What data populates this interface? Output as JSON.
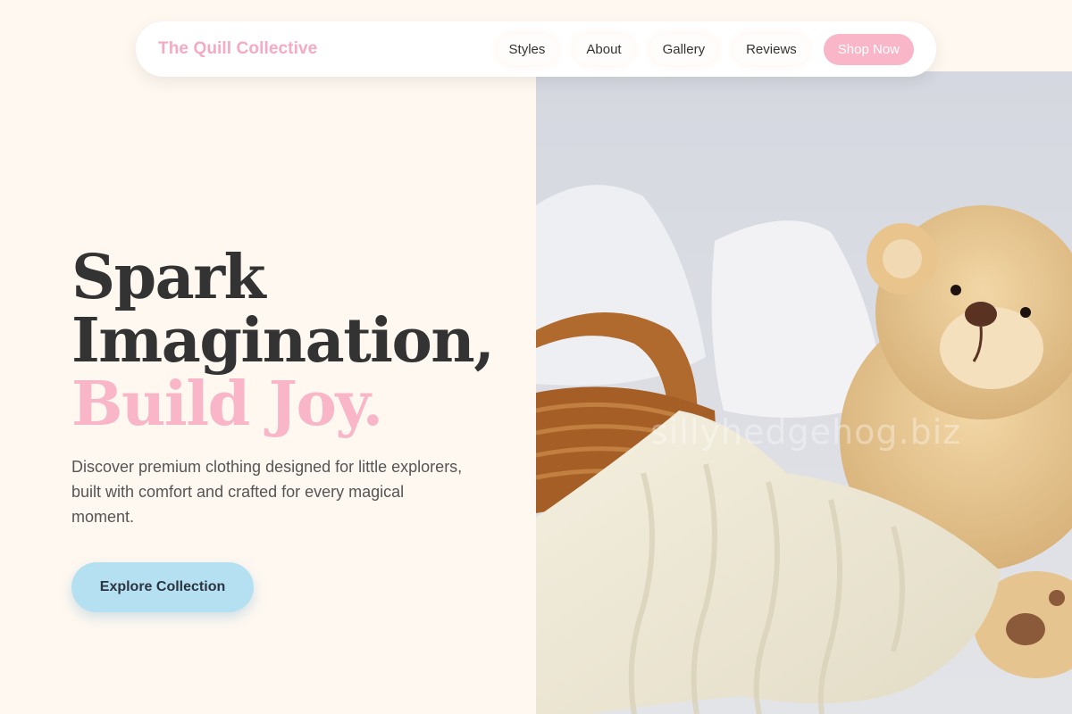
{
  "brand": {
    "name": "The Quill Collective",
    "color": "#f4aac3"
  },
  "nav": {
    "links": [
      {
        "label": "Styles"
      },
      {
        "label": "About"
      },
      {
        "label": "Gallery"
      },
      {
        "label": "Reviews"
      }
    ],
    "cta_label": "Shop Now"
  },
  "hero": {
    "headline_line1": "Spark",
    "headline_line2": "Imagination,",
    "headline_accent": "Build Joy.",
    "subtitle": "Discover premium clothing designed for little explorers, built with comfort and crafted for every magical moment.",
    "cta_label": "Explore Collection"
  },
  "image": {
    "watermark": "sillyhedgehog.biz"
  },
  "colors": {
    "page_bg": "#fff8f1",
    "accent_pink": "#f8b6c8",
    "cta_blue": "#b4e0f2",
    "text_dark": "#333333"
  }
}
